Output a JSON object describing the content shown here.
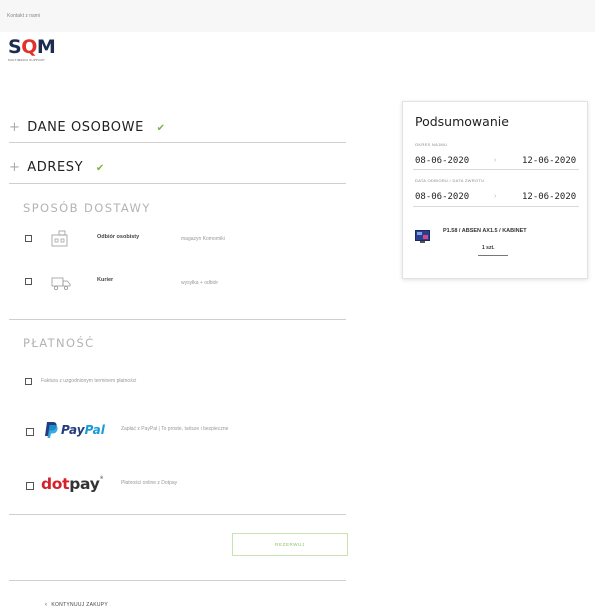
{
  "header": {
    "contact": "Kontakt z nami",
    "logo_text_1": "S",
    "logo_text_2": "Q",
    "logo_text_3": "M",
    "logo_sub": "MULTIMEDIA SUPPORT"
  },
  "steps": {
    "personal": {
      "label": "DANE OSOBOWE",
      "completed": true
    },
    "addresses": {
      "label": "ADRESY",
      "completed": true
    }
  },
  "delivery": {
    "heading": "SPOSÓB DOSTAWY",
    "options": [
      {
        "label": "Odbiór osobisty",
        "description": "magazyn Komorniki",
        "icon": "warehouse-icon"
      },
      {
        "label": "Kurier",
        "description": "wysyłka + odbiór",
        "icon": "truck-icon"
      }
    ]
  },
  "payment": {
    "heading": "PŁATNOŚĆ",
    "options": [
      {
        "label": "Faktura z uzgodnionym terminem płatności"
      },
      {
        "brand_pay": "Pay",
        "brand_pal": "Pal",
        "description": "Zapłać z PayPal | To proste, tańsze i bezpieczne"
      },
      {
        "brand_dot": "dot",
        "brand_pay": "pay",
        "description": "Płatności online z Dotpay"
      }
    ]
  },
  "actions": {
    "reserve": "REZERWUJ",
    "continue": "KONTYNUUJ ZAKUPY"
  },
  "summary": {
    "title": "Podsumowanie",
    "rental_label": "OKRES NAJMU",
    "rental_from": "08-06-2020",
    "rental_to": "12-06-2020",
    "pickup_label": "DATA ODBIORU / DATA ZWROTU",
    "pickup_from": "08-06-2020",
    "pickup_to": "12-06-2020",
    "product_name": "P1.58 / ABSEN AX1.5 / KABINET",
    "quantity": "1 szt."
  },
  "colors": {
    "accent_green": "#7cb342",
    "logo_navy": "#1d2d4f",
    "logo_red": "#e0312b",
    "paypal_dark": "#253b80",
    "paypal_light": "#179bd7",
    "dotpay_red": "#d4212a"
  }
}
